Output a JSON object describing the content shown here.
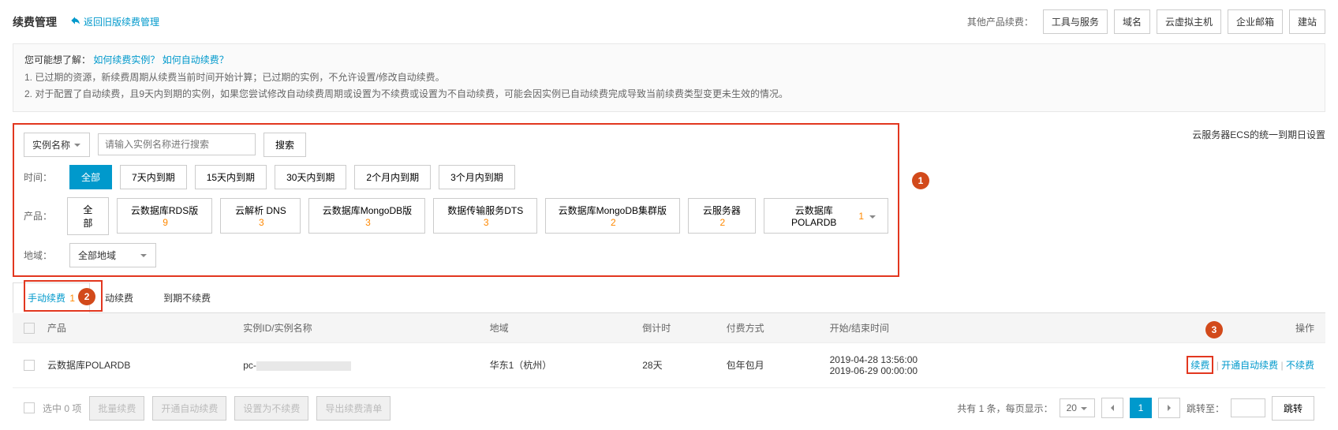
{
  "header": {
    "title": "续费管理",
    "back_link": "返回旧版续费管理",
    "other_label": "其他产品续费：",
    "head_buttons": [
      "工具与服务",
      "域名",
      "云虚拟主机",
      "企业邮箱",
      "建站"
    ]
  },
  "info": {
    "prefix": "您可能想了解：",
    "links": [
      "如何续费实例？",
      "如何自动续费？"
    ],
    "line1": "1. 已过期的资源，新续费周期从续费当前时间开始计算；已过期的实例，不允许设置/修改自动续费。",
    "line2": "2. 对于配置了自动续费，且9天内到期的实例，如果您尝试修改自动续费周期或设置为不续费或设置为不自动续费，可能会因实例已自动续费完成导致当前续费类型变更未生效的情况。"
  },
  "filters": {
    "select_label": "实例名称",
    "search_placeholder": "请输入实例名称进行搜索",
    "search_btn": "搜索",
    "time_label": "时间：",
    "time_options": [
      "全部",
      "7天内到期",
      "15天内到期",
      "30天内到期",
      "2个月内到期",
      "3个月内到期"
    ],
    "product_label": "产品：",
    "products": [
      {
        "name": "全部",
        "count": ""
      },
      {
        "name": "云数据库RDS版",
        "count": "9"
      },
      {
        "name": "云解析 DNS",
        "count": "3"
      },
      {
        "name": "云数据库MongoDB版",
        "count": "3"
      },
      {
        "name": "数据传输服务DTS",
        "count": "3"
      },
      {
        "name": "云数据库MongoDB集群版",
        "count": "2"
      },
      {
        "name": "云服务器",
        "count": "2"
      },
      {
        "name": "云数据库POLARDB",
        "count": "1"
      }
    ],
    "region_label": "地域：",
    "region_value": "全部地域"
  },
  "unified": {
    "prefix": "云服务器ECS的",
    "link": "统一到期日设置"
  },
  "tabs": {
    "manual": "手动续费",
    "manual_count": "1",
    "auto_prefix": "动续费",
    "norenew": "到期不续费"
  },
  "table": {
    "cols": [
      "产品",
      "实例ID/实例名称",
      "地域",
      "倒计时",
      "付费方式",
      "开始/结束时间",
      "操作"
    ],
    "row": {
      "product": "云数据库POLARDB",
      "instance_prefix": "pc-",
      "region": "华东1（杭州）",
      "countdown": "28天",
      "payment": "包年包月",
      "start": "2019-04-28 13:56:00",
      "end": "2019-06-29 00:00:00",
      "ops": {
        "renew": "续费",
        "auto": "开通自动续费",
        "norenew": "不续费"
      }
    }
  },
  "footer": {
    "selected": "选中 0 项",
    "batch_buttons": [
      "批量续费",
      "开通自动续费",
      "设置为不续费",
      "导出续费清单"
    ],
    "total": "共有 1 条，每页显示：",
    "page_size": "20",
    "page": "1",
    "jump_label": "跳转至：",
    "jump_btn": "跳转"
  },
  "callouts": {
    "c1": "1",
    "c2": "2",
    "c3": "3"
  }
}
